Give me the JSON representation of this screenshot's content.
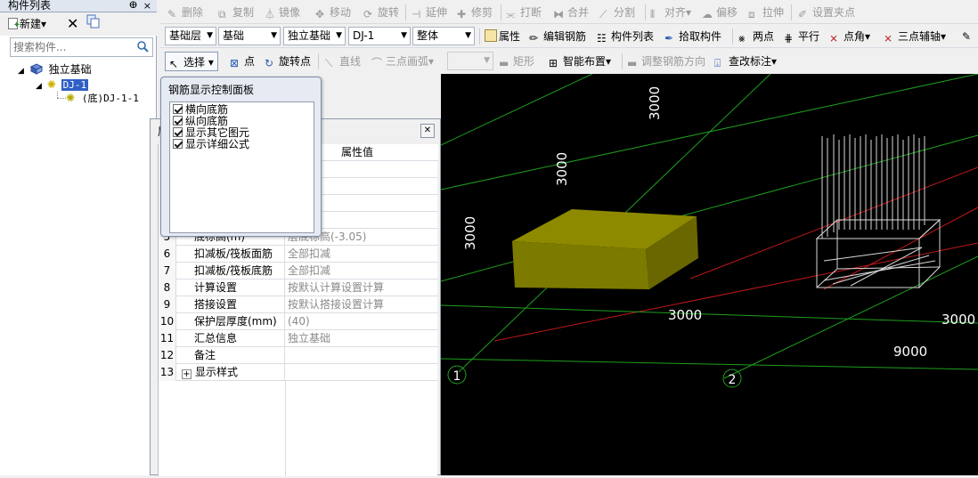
{
  "left_panel": {
    "title": "构件列表",
    "pin_icon": "pin-icon",
    "new_label": "新建",
    "search_placeholder": "搜索构件...",
    "tree": {
      "root": "独立基础",
      "child": "DJ-1",
      "grandchild": "(底)DJ-1-1"
    }
  },
  "toolbar1": {
    "delete": "删除",
    "copy": "复制",
    "mirror": "镜像",
    "move": "移动",
    "rotate": "旋转",
    "extend": "延伸",
    "trim": "修剪",
    "break": "打断",
    "merge": "合并",
    "split": "分割",
    "align": "对齐",
    "offset": "偏移",
    "stretch": "拉伸",
    "set_grip": "设置夹点"
  },
  "toolbar2": {
    "floor": "基础层",
    "category": "基础",
    "type": "独立基础",
    "element": "DJ-1",
    "scope": "整体",
    "property": "属性",
    "edit_rebar": "编辑钢筋",
    "element_list": "构件列表",
    "pick_element": "拾取构件",
    "two_points": "两点",
    "parallel": "平行",
    "point_angle": "点角",
    "three_point_axis": "三点辅轴"
  },
  "toolbar3": {
    "select": "选择",
    "point": "点",
    "rotate_point": "旋转点",
    "line": "直线",
    "three_point_arc": "三点画弧",
    "rect": "矩形",
    "smart_place": "智能布置",
    "adjust_rebar": "调整钢筋方向",
    "edit_label": "查改标注"
  },
  "rebar_panel": {
    "title": "钢筋显示控制面板",
    "items": [
      {
        "label": "横向底筋",
        "checked": true
      },
      {
        "label": "纵向底筋",
        "checked": true
      },
      {
        "label": "显示其它图元",
        "checked": true
      },
      {
        "label": "显示详细公式",
        "checked": true
      }
    ]
  },
  "properties": {
    "header_value": "属性值",
    "header_name_partial": "属",
    "rows": [
      {
        "num": "5",
        "name": "底标高(m)",
        "value": "层底标高(-3.05)"
      },
      {
        "num": "6",
        "name": "扣减板/筏板面筋",
        "value": "全部扣减"
      },
      {
        "num": "7",
        "name": "扣减板/筏板底筋",
        "value": "全部扣减"
      },
      {
        "num": "8",
        "name": "计算设置",
        "value": "按默认计算设置计算"
      },
      {
        "num": "9",
        "name": "搭接设置",
        "value": "按默认搭接设置计算"
      },
      {
        "num": "10",
        "name": "保护层厚度(mm)",
        "value": "(40)"
      },
      {
        "num": "11",
        "name": "汇总信息",
        "value": "独立基础"
      },
      {
        "num": "12",
        "name": "备注",
        "value": ""
      },
      {
        "num": "13",
        "name": "显示样式",
        "value": "",
        "expandable": true
      }
    ]
  },
  "canvas": {
    "dims": {
      "d1": "3000",
      "d2": "3000",
      "d3": "3000",
      "d4": "3000",
      "d5": "3000",
      "d6": "9000"
    },
    "axis_labels": {
      "a1": "1",
      "a2": "2"
    },
    "colors": {
      "grid_green": "#1e9e1e",
      "grid_red": "#c01818",
      "block": "#7d7a00",
      "text": "#ffffff"
    }
  }
}
